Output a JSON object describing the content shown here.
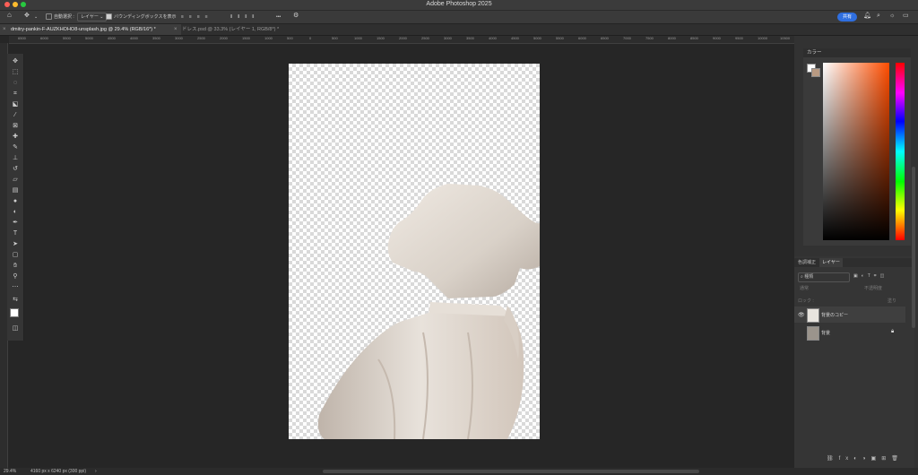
{
  "window": {
    "title": "Adobe Photoshop 2025"
  },
  "options_bar": {
    "auto_select_label": "自動選択 :",
    "target_select": "レイヤー",
    "show_bbox_label": "バウンディングボックスを表示",
    "more_label": "•••",
    "share_label": "共有"
  },
  "tabs": [
    {
      "label": "dmitry-pankin-F-AUZKHOHO8-unsplash.jpg @ 29.4% (RGB/16*) *"
    },
    {
      "label": "ドレス.psd @ 33.3% (レイヤー 1, RGB/8*) *"
    }
  ],
  "ruler_ticks": [
    "6500",
    "6000",
    "5500",
    "5000",
    "4500",
    "4000",
    "3500",
    "3000",
    "2500",
    "2000",
    "1500",
    "1000",
    "500",
    "0",
    "500",
    "1000",
    "1500",
    "2000",
    "2500",
    "3000",
    "3500",
    "4000",
    "4500",
    "5000",
    "5500",
    "6000",
    "6500",
    "7000",
    "7500",
    "8000",
    "8500",
    "9000",
    "9500",
    "10000",
    "10500"
  ],
  "color_panel": {
    "title": "カラー"
  },
  "layers_panel": {
    "tabs": [
      "色調補正",
      "レイヤー"
    ],
    "filter_label": "種類",
    "mode_label": "通常",
    "opacity_label": "不透明度",
    "lock_label": "ロック :",
    "fill_label": "塗り",
    "layers": [
      {
        "name": "背景のコピー",
        "visible": true
      },
      {
        "name": "背景",
        "visible": false,
        "locked": true
      }
    ]
  },
  "status": {
    "zoom": "29.4%",
    "doc_info": "4160 px x 6240 px (300 ppi)"
  }
}
